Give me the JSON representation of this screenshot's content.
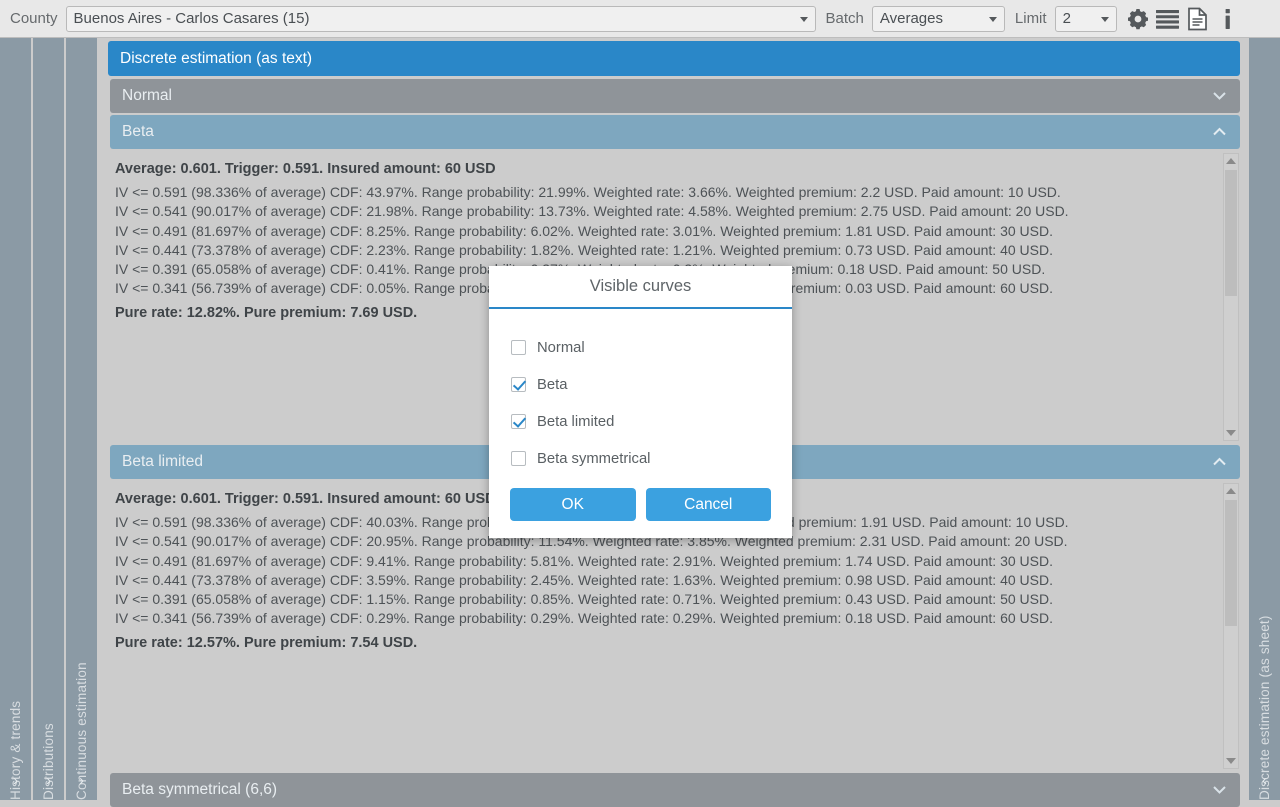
{
  "toolbar": {
    "county_label": "County",
    "county_value": "Buenos Aires - Carlos Casares (15)",
    "batch_label": "Batch",
    "batch_value": "Averages",
    "limit_label": "Limit",
    "limit_value": "2",
    "icons": [
      "gear-icon",
      "list-icon",
      "sheet-icon",
      "info-icon"
    ]
  },
  "left_tabs": [
    {
      "label": "History & trends",
      "chevron": "›"
    },
    {
      "label": "Distributions",
      "chevron": "›"
    },
    {
      "label": "Continuous estimation",
      "chevron": "›"
    }
  ],
  "right_tabs": [
    {
      "label": "Discrete estimation (as sheet)",
      "chevron": "‹"
    }
  ],
  "main": {
    "title": "Discrete estimation (as text)",
    "sections": [
      {
        "label": "Normal",
        "state": "collapsed",
        "style": "gray"
      },
      {
        "label": "Beta",
        "state": "expanded",
        "style": "blue"
      },
      {
        "label": "Beta limited",
        "state": "expanded",
        "style": "blue"
      },
      {
        "label": "Beta symmetrical (6,6)",
        "state": "collapsed",
        "style": "gray"
      }
    ]
  },
  "beta": {
    "header": "Average: 0.601. Trigger: 0.591. Insured amount: 60 USD",
    "lines": [
      "IV <= 0.591 (98.336% of average) CDF: 43.97%. Range probability: 21.99%. Weighted rate: 3.66%. Weighted premium: 2.2 USD. Paid amount: 10 USD.",
      "IV <= 0.541 (90.017% of average) CDF: 21.98%. Range probability: 13.73%. Weighted rate: 4.58%. Weighted premium: 2.75 USD. Paid amount: 20 USD.",
      "IV <= 0.491 (81.697% of average) CDF: 8.25%. Range probability: 6.02%. Weighted rate: 3.01%. Weighted premium: 1.81 USD. Paid amount: 30 USD.",
      "IV <= 0.441 (73.378% of average) CDF: 2.23%. Range probability: 1.82%. Weighted rate: 1.21%. Weighted premium: 0.73 USD. Paid amount: 40 USD.",
      "IV <= 0.391 (65.058% of average) CDF: 0.41%. Range probability: 0.37%. Weighted rate: 0.3%. Weighted premium: 0.18 USD. Paid amount: 50 USD.",
      "IV <= 0.341 (56.739% of average) CDF: 0.05%. Range probability: 0.05%. Weighted rate: 0.05%. Weighted premium: 0.03 USD. Paid amount: 60 USD."
    ],
    "footer": "Pure rate: 12.82%. Pure premium: 7.69 USD."
  },
  "beta_limited": {
    "header": "Average: 0.601. Trigger: 0.591. Insured amount: 60 USD",
    "lines": [
      "IV <= 0.591 (98.336% of average) CDF: 40.03%. Range probability: 19.09%. Weighted rate: 3.18%. Weighted premium: 1.91 USD. Paid amount: 10 USD.",
      "IV <= 0.541 (90.017% of average) CDF: 20.95%. Range probability: 11.54%. Weighted rate: 3.85%. Weighted premium: 2.31 USD. Paid amount: 20 USD.",
      "IV <= 0.491 (81.697% of average) CDF: 9.41%. Range probability: 5.81%. Weighted rate: 2.91%. Weighted premium: 1.74 USD. Paid amount: 30 USD.",
      "IV <= 0.441 (73.378% of average) CDF: 3.59%. Range probability: 2.45%. Weighted rate: 1.63%. Weighted premium: 0.98 USD. Paid amount: 40 USD.",
      "IV <= 0.391 (65.058% of average) CDF: 1.15%. Range probability: 0.85%. Weighted rate: 0.71%. Weighted premium: 0.43 USD. Paid amount: 50 USD.",
      "IV <= 0.341 (56.739% of average) CDF: 0.29%. Range probability: 0.29%. Weighted rate: 0.29%. Weighted premium: 0.18 USD. Paid amount: 60 USD."
    ],
    "footer": "Pure rate: 12.57%. Pure premium: 7.54 USD."
  },
  "modal": {
    "title": "Visible curves",
    "options": [
      {
        "label": "Normal",
        "checked": false
      },
      {
        "label": "Beta",
        "checked": true
      },
      {
        "label": "Beta limited",
        "checked": true
      },
      {
        "label": "Beta symmetrical",
        "checked": false
      }
    ],
    "ok_label": "OK",
    "cancel_label": "Cancel"
  },
  "colors": {
    "accent": "#2a87c8",
    "button": "#3ba1e0",
    "tab": "#8b9aa5",
    "section_gray": "#8f9499",
    "section_blue": "#7ea7bf",
    "content_bg": "#cccccc",
    "topbar_bg": "#e8e8e8"
  }
}
